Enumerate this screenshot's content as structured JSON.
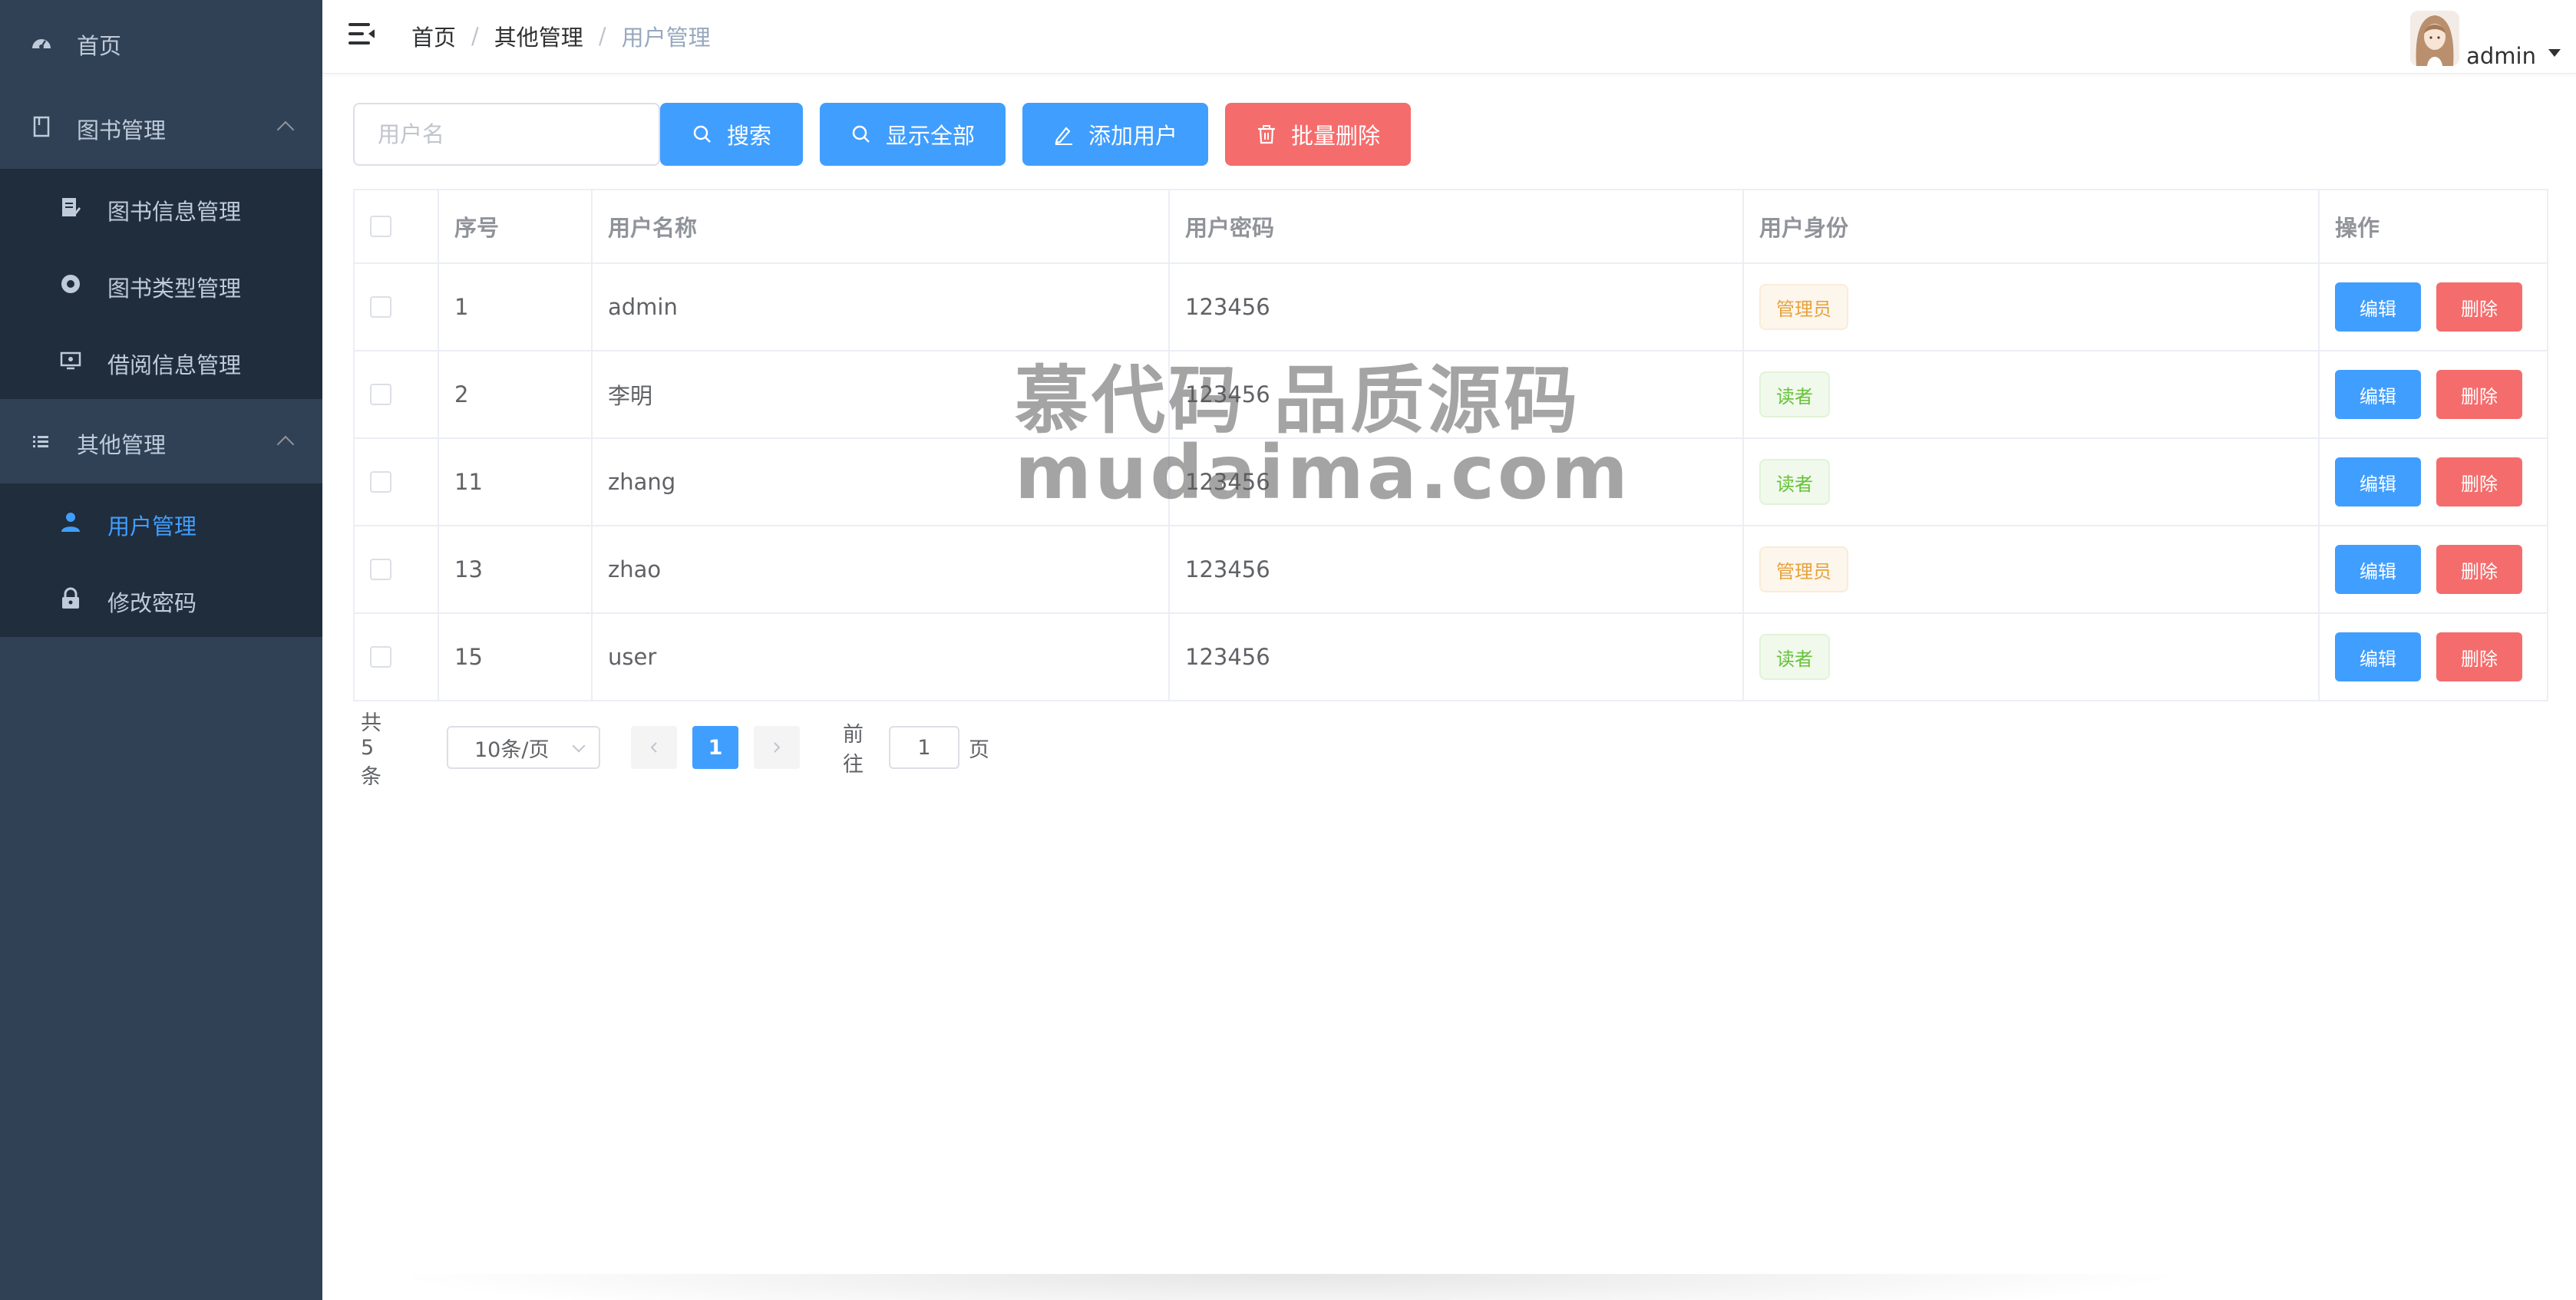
{
  "sidebar": {
    "home": "首页",
    "book_group": {
      "label": "图书管理",
      "items": [
        "图书信息管理",
        "图书类型管理",
        "借阅信息管理"
      ]
    },
    "other_group": {
      "label": "其他管理",
      "items": [
        "用户管理",
        "修改密码"
      ]
    }
  },
  "header": {
    "breadcrumb": [
      "首页",
      "其他管理",
      "用户管理"
    ],
    "username": "admin"
  },
  "toolbar": {
    "search_placeholder": "用户名",
    "search": "搜索",
    "show_all": "显示全部",
    "add_user": "添加用户",
    "batch_delete": "批量删除"
  },
  "table": {
    "columns": [
      "序号",
      "用户名称",
      "用户密码",
      "用户身份",
      "操作"
    ],
    "rows": [
      {
        "id": "1",
        "name": "admin",
        "password": "123456",
        "role": "管理员"
      },
      {
        "id": "2",
        "name": "李明",
        "password": "123456",
        "role": "读者"
      },
      {
        "id": "11",
        "name": "zhang",
        "password": "123456",
        "role": "读者"
      },
      {
        "id": "13",
        "name": "zhao",
        "password": "123456",
        "role": "管理员"
      },
      {
        "id": "15",
        "name": "user",
        "password": "123456",
        "role": "读者"
      }
    ],
    "edit": "编辑",
    "delete": "删除"
  },
  "pagination": {
    "total": "共 5 条",
    "page_size": "10条/页",
    "current_page": "1",
    "goto_prefix": "前往",
    "goto_value": "1",
    "goto_suffix": "页"
  },
  "watermark": {
    "line1": "慕代码 品质源码",
    "line2": "mudaima.com"
  },
  "colors": {
    "sidebar_bg": "#304156",
    "submenu_bg": "#1f2d3d",
    "primary": "#409eff",
    "danger": "#f56c6c",
    "tag_admin": "#e6a23c",
    "tag_reader": "#67c23a"
  }
}
